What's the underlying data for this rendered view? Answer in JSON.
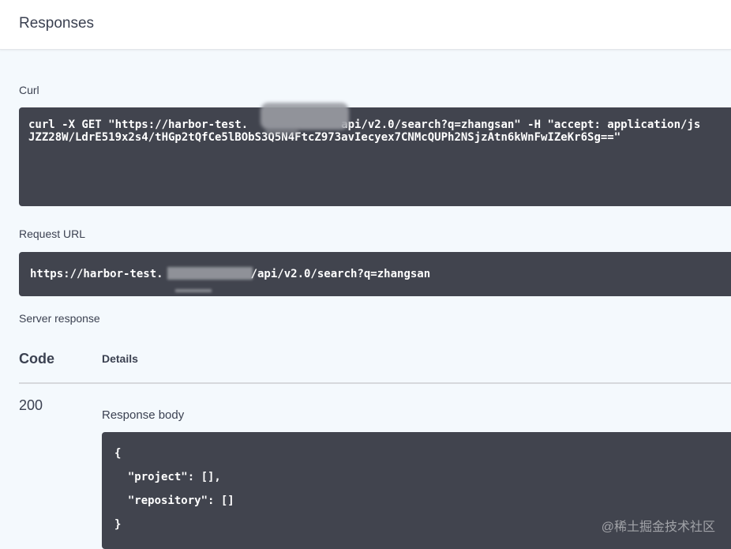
{
  "header": {
    "title": "Responses"
  },
  "curl": {
    "label": "Curl",
    "line1_a": "curl -X GET \"https://harbor-test.",
    "line1_b": "api/v2.0/search?q=zhangsan\" -H \"accept: application/js",
    "line2": "JZZ28W/LdrE519x2s4/tHGp2tQfCe5lBObS3Q5N4FtcZ973avIecyex7CNMcQUPh2NSjzAtn6kWnFwIZeKr6Sg==\""
  },
  "request_url": {
    "label": "Request URL",
    "url_a": "https://harbor-test.",
    "url_b": "/api/v2.0/search?q=zhangsan"
  },
  "server_response": {
    "label": "Server response",
    "col_code": "Code",
    "col_details": "Details",
    "code": "200",
    "body_label": "Response body",
    "body_lines": [
      "{",
      "  \"project\": [],",
      "  \"repository\": []",
      "}"
    ]
  },
  "watermark": "@稀土掘金技术社区"
}
